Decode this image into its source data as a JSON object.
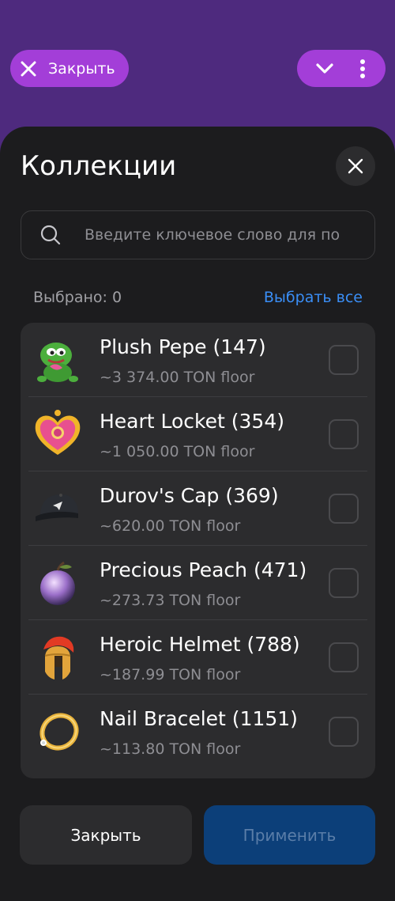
{
  "topbar": {
    "close_label": "Закрыть"
  },
  "sheet": {
    "title": "Коллекции",
    "search_placeholder": "Введите ключевое слово для по",
    "selected_text": "Выбрано: 0",
    "select_all_label": "Выбрать все"
  },
  "items": [
    {
      "name": "Plush Pepe (147)",
      "floor": "~3 374.00 TON floor",
      "icon": "plush-pepe"
    },
    {
      "name": "Heart Locket (354)",
      "floor": "~1 050.00 TON floor",
      "icon": "heart-locket"
    },
    {
      "name": "Durov's Cap (369)",
      "floor": "~620.00 TON floor",
      "icon": "durovs-cap"
    },
    {
      "name": "Precious Peach (471)",
      "floor": "~273.73 TON floor",
      "icon": "precious-peach"
    },
    {
      "name": "Heroic Helmet (788)",
      "floor": "~187.99 TON floor",
      "icon": "heroic-helmet"
    },
    {
      "name": "Nail Bracelet (1151)",
      "floor": "~113.80 TON floor",
      "icon": "nail-bracelet"
    }
  ],
  "footer": {
    "close_label": "Закрыть",
    "apply_label": "Применить"
  },
  "colors": {
    "header_bg": "#4e2a7e",
    "pill": "#a33ed8",
    "sheet_bg": "#1c1c1e",
    "accent": "#3a8ef6",
    "apply_bg": "#0c3f79"
  }
}
